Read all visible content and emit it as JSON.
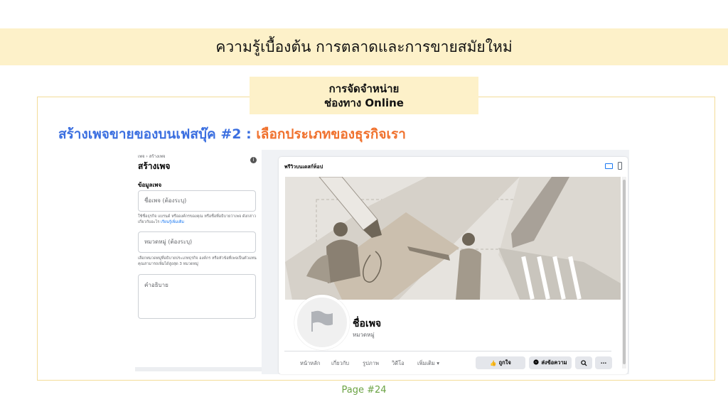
{
  "slide": {
    "title": "ความรู้เบื้องต้น การตลาดและการขายสมัยใหม่",
    "subheading_line1": "การจัดจำหน่าย",
    "subheading_line2": "ช่องทาง Online",
    "heading_blue": "สร้างเพจขายของบนเฟสบุ๊ค #2 : ",
    "heading_orange": "เลือกประเภทของธุรกิจเรา",
    "page_number": "Page #24"
  },
  "form": {
    "breadcrumb": "เพจ › สร้างเพจ",
    "title": "สร้างเพจ",
    "section": "ข้อมูลเพจ",
    "name_placeholder": "ชื่อเพจ (ต้องระบุ)",
    "name_help": "ใช้ชื่อธุรกิจ แบรนด์ หรือองค์กรของคุณ หรือชื่อที่อธิบายว่าเพจ ดังกล่าวเกี่ยวกับอะไร ",
    "name_help_link": "เรียนรู้เพิ่มเติม",
    "category_placeholder": "หมวดหมู่ (ต้องระบุ)",
    "category_help": "เลือกหมวดหมู่ที่อธิบายประเภทธุรกิจ องค์กร หรือหัวข้อที่เพจเป็นตัวแทน คุณสามารถเพิ่มได้สูงสุด 3 หมวดหมู่",
    "description_placeholder": "คำอธิบาย"
  },
  "preview": {
    "title": "พรีวิวบนเดสก์ท็อป",
    "page_name": "ชื่อเพจ",
    "category": "หมวดหมู่",
    "tabs": [
      "หน้าหลัก",
      "เกี่ยวกับ",
      "รูปภาพ",
      "วิดีโอ",
      "เพิ่มเติม ▾"
    ],
    "like_button": "ถูกใจ",
    "message_button": "ส่งข้อความ",
    "more_button": "···"
  },
  "colors": {
    "banner": "#fdf1c9",
    "heading_blue": "#3b6fe0",
    "heading_orange": "#f0712d",
    "page_number": "#6ba344",
    "facebook_blue": "#1877f2"
  }
}
